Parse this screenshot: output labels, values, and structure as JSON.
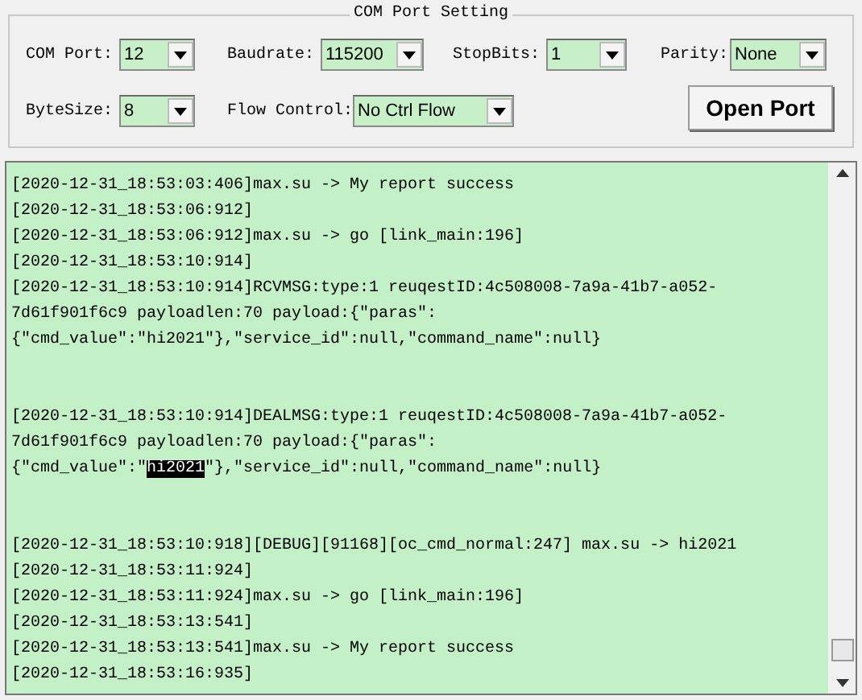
{
  "settings": {
    "title": "COM Port Setting",
    "fields": [
      {
        "label": "COM Port:",
        "value": "12"
      },
      {
        "label": "Baudrate:",
        "value": "115200"
      },
      {
        "label": "StopBits:",
        "value": "1"
      },
      {
        "label": "Parity:",
        "value": "None"
      },
      {
        "label": "ByteSize:",
        "value": "8"
      },
      {
        "label": "Flow Control:",
        "value": "No Ctrl Flow"
      }
    ],
    "button": "Open Port"
  },
  "log": {
    "lines": [
      {
        "kind": "text",
        "segments": [
          {
            "text": "[2020-12-31_18:53:03:406]max.su -> My report success",
            "selected": false
          }
        ]
      },
      {
        "kind": "text",
        "segments": [
          {
            "text": "[2020-12-31_18:53:06:912]",
            "selected": false
          }
        ]
      },
      {
        "kind": "text",
        "segments": [
          {
            "text": "[2020-12-31_18:53:06:912]max.su -> go [link_main:196]",
            "selected": false
          }
        ]
      },
      {
        "kind": "text",
        "segments": [
          {
            "text": "[2020-12-31_18:53:10:914]",
            "selected": false
          }
        ]
      },
      {
        "kind": "text",
        "segments": [
          {
            "text": "[2020-12-31_18:53:10:914]RCVMSG:type:1 reuqestID:4c508008-7a9a-41b7-a052-",
            "selected": false
          }
        ]
      },
      {
        "kind": "text",
        "segments": [
          {
            "text": "7d61f901f6c9 payloadlen:70 payload:{\"paras\":",
            "selected": false
          }
        ]
      },
      {
        "kind": "text",
        "segments": [
          {
            "text": "{\"cmd_value\":\"hi2021\"},\"service_id\":null,\"command_name\":null}",
            "selected": false
          }
        ]
      },
      {
        "kind": "blank"
      },
      {
        "kind": "blank"
      },
      {
        "kind": "text",
        "segments": [
          {
            "text": "[2020-12-31_18:53:10:914]DEALMSG:type:1 reuqestID:4c508008-7a9a-41b7-a052-",
            "selected": false
          }
        ]
      },
      {
        "kind": "text",
        "segments": [
          {
            "text": "7d61f901f6c9 payloadlen:70 payload:{\"paras\":",
            "selected": false
          }
        ]
      },
      {
        "kind": "text",
        "segments": [
          {
            "text": "{\"cmd_value\":\"",
            "selected": false
          },
          {
            "text": "hi2021",
            "selected": true
          },
          {
            "text": "\"},\"service_id\":null,\"command_name\":null}",
            "selected": false
          }
        ]
      },
      {
        "kind": "blank"
      },
      {
        "kind": "blank"
      },
      {
        "kind": "text",
        "segments": [
          {
            "text": "[2020-12-31_18:53:10:918][DEBUG][91168][oc_cmd_normal:247] max.su -> hi2021",
            "selected": false
          }
        ]
      },
      {
        "kind": "text",
        "segments": [
          {
            "text": "[2020-12-31_18:53:11:924]",
            "selected": false
          }
        ]
      },
      {
        "kind": "text",
        "segments": [
          {
            "text": "[2020-12-31_18:53:11:924]max.su -> go [link_main:196]",
            "selected": false
          }
        ]
      },
      {
        "kind": "text",
        "segments": [
          {
            "text": "[2020-12-31_18:53:13:541]",
            "selected": false
          }
        ]
      },
      {
        "kind": "text",
        "segments": [
          {
            "text": "[2020-12-31_18:53:13:541]max.su -> My report success",
            "selected": false
          }
        ]
      },
      {
        "kind": "text",
        "segments": [
          {
            "text": "[2020-12-31_18:53:16:935]",
            "selected": false
          }
        ]
      }
    ]
  }
}
